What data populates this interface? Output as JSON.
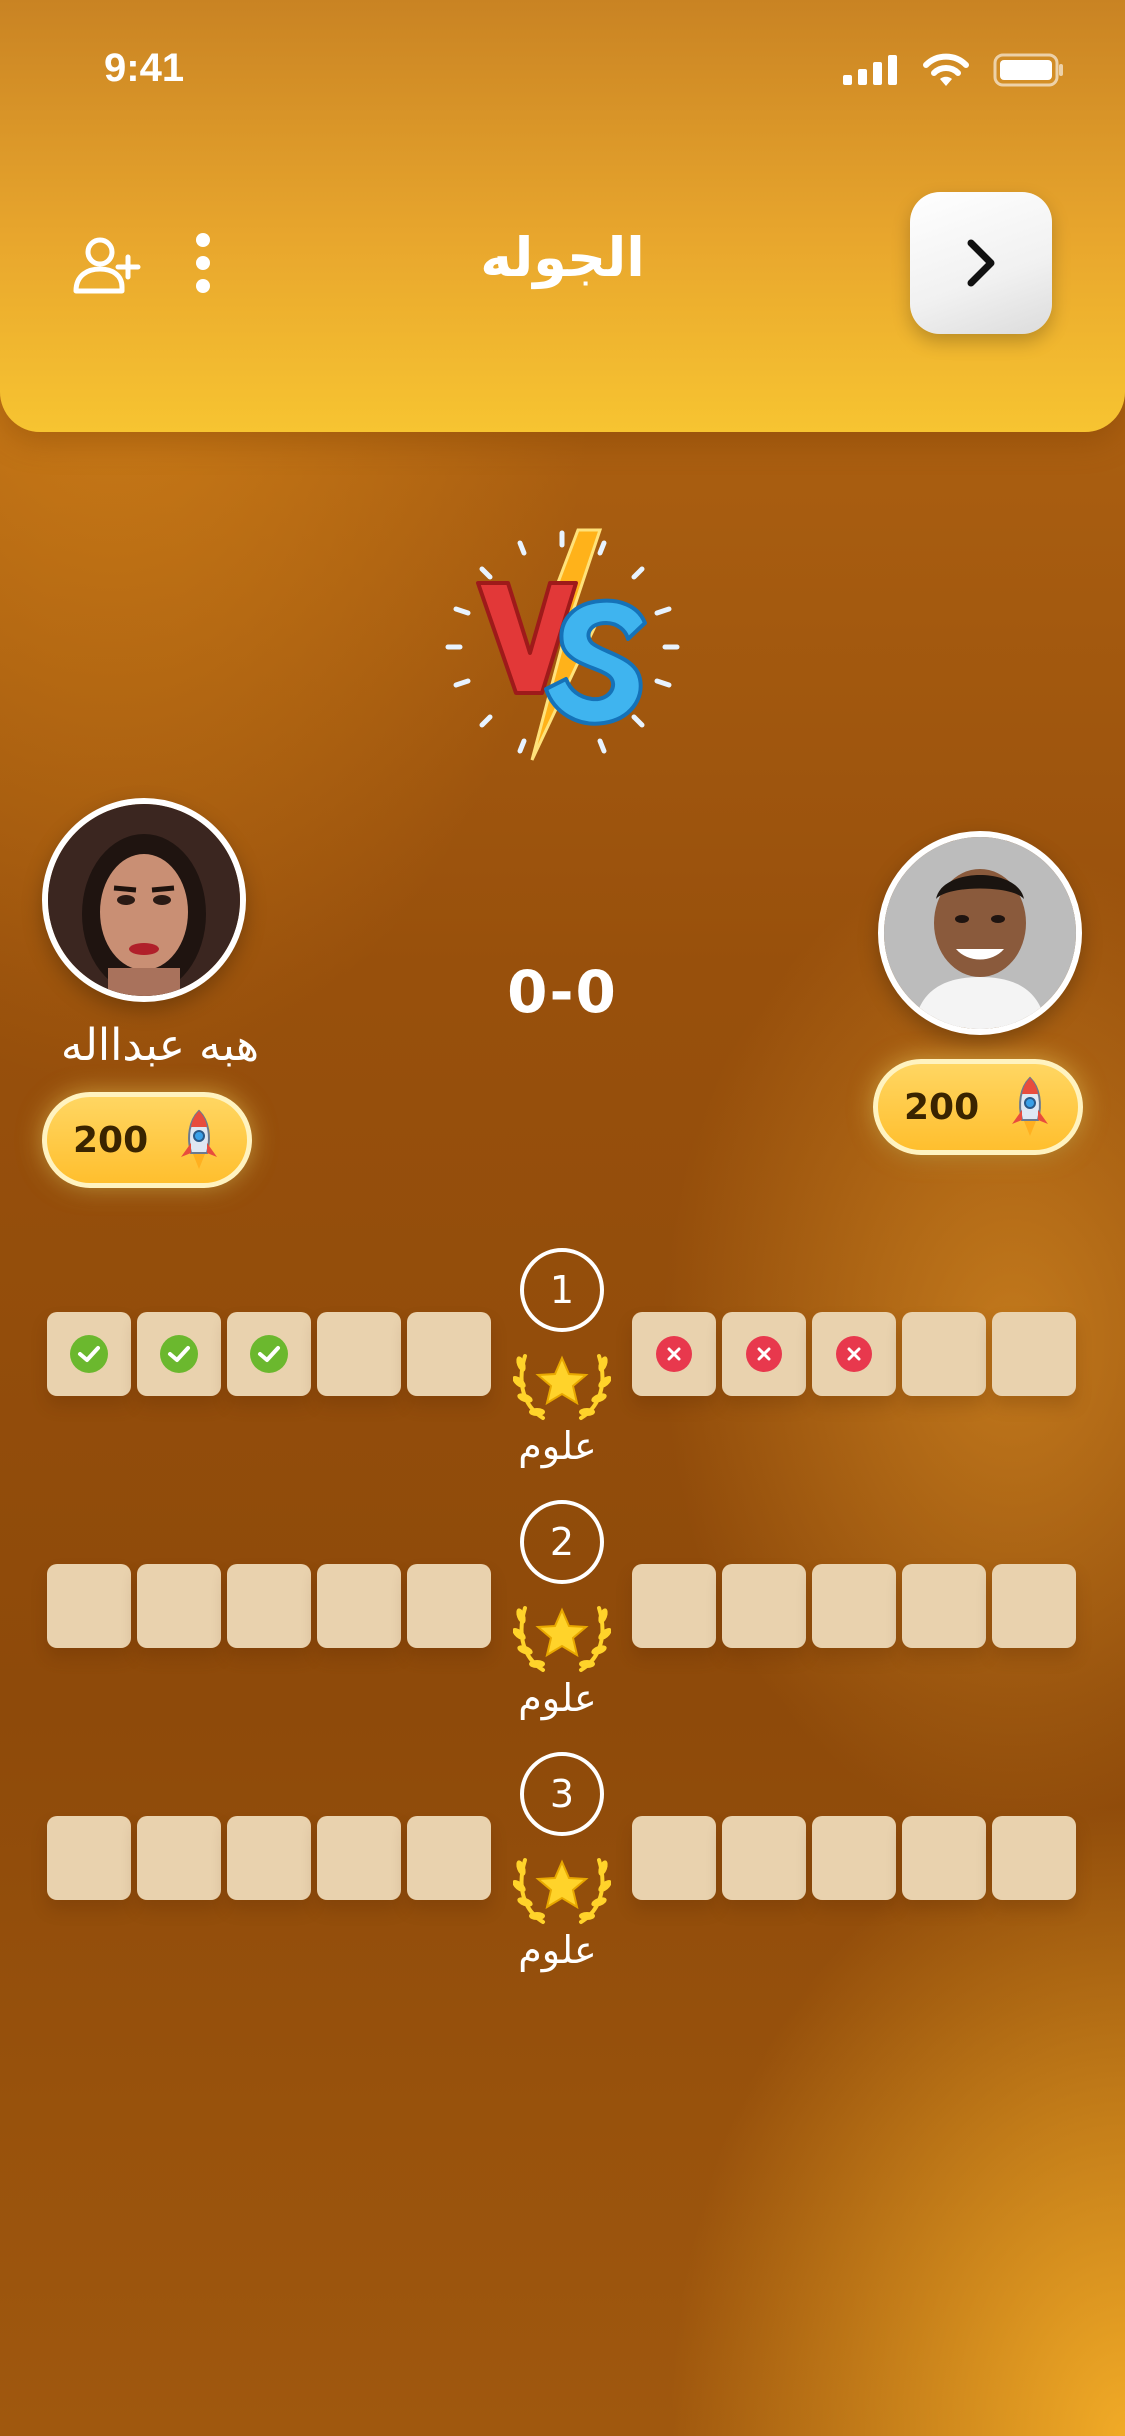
{
  "status_bar": {
    "time": "9:41"
  },
  "header": {
    "title": "الجوله"
  },
  "icons": {
    "back": "chevron-right-icon",
    "more": "more-vertical-icon",
    "add_user": "user-plus-icon",
    "vs": "vs-icon",
    "coin": "rocket-icon",
    "round_badge": "laurel-star-icon"
  },
  "players": {
    "left": {
      "name": "هبه عبدااله",
      "coins": "200"
    },
    "right": {
      "name": "",
      "coins": "200"
    }
  },
  "score": "0-0",
  "rounds": [
    {
      "number": "1",
      "category": "علوم",
      "left": [
        "correct",
        "correct",
        "correct",
        "empty",
        "empty"
      ],
      "right": [
        "wrong",
        "wrong",
        "wrong",
        "empty",
        "empty"
      ]
    },
    {
      "number": "2",
      "category": "علوم",
      "left": [
        "empty",
        "empty",
        "empty",
        "empty",
        "empty"
      ],
      "right": [
        "empty",
        "empty",
        "empty",
        "empty",
        "empty"
      ]
    },
    {
      "number": "3",
      "category": "علوم",
      "left": [
        "empty",
        "empty",
        "empty",
        "empty",
        "empty"
      ],
      "right": [
        "empty",
        "empty",
        "empty",
        "empty",
        "empty"
      ]
    }
  ],
  "colors": {
    "header_top": "#c98323",
    "header_bottom": "#f7c431",
    "correct": "#6bb82e",
    "wrong": "#e8384d",
    "box": "#e9d2ae"
  }
}
